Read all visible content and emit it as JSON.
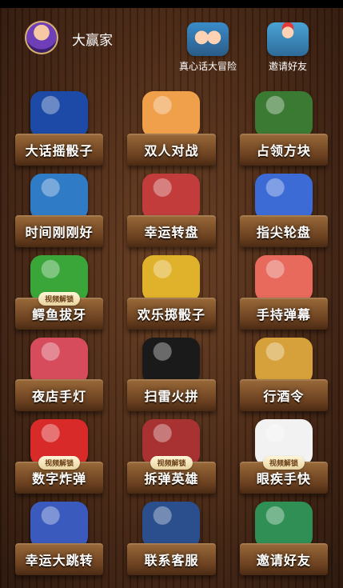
{
  "header": {
    "username": "大赢家",
    "actions": [
      {
        "label": "真心话大冒险",
        "icon": "truth-or-dare-icon"
      },
      {
        "label": "邀请好友",
        "icon": "invite-friend-icon"
      }
    ]
  },
  "games": [
    {
      "label": "大话摇骰子",
      "icon": "dice-cup-icon",
      "color": "#1c4aa6",
      "badge": ""
    },
    {
      "label": "双人对战",
      "icon": "fists-battle-icon",
      "color": "#f0a04b",
      "badge": ""
    },
    {
      "label": "占领方块",
      "icon": "soldiers-icon",
      "color": "#3b7a33",
      "badge": ""
    },
    {
      "label": "时间刚刚好",
      "icon": "clock-person-icon",
      "color": "#2f7bc6",
      "badge": ""
    },
    {
      "label": "幸运转盘",
      "icon": "lucky-wheel-icon",
      "color": "#c23c3c",
      "badge": ""
    },
    {
      "label": "指尖轮盘",
      "icon": "finger-spinner-icon",
      "color": "#3c6bd6",
      "badge": ""
    },
    {
      "label": "鳄鱼拔牙",
      "icon": "crocodile-icon",
      "color": "#3aa63a",
      "badge": "视频解锁"
    },
    {
      "label": "欢乐掷骰子",
      "icon": "golden-dice-icon",
      "color": "#e0b12a",
      "badge": ""
    },
    {
      "label": "手持弹幕",
      "icon": "handheld-phone-icon",
      "color": "#e76a5c",
      "badge": ""
    },
    {
      "label": "夜店手灯",
      "icon": "nightclub-light-icon",
      "color": "#d64c5c",
      "badge": ""
    },
    {
      "label": "扫雷火拼",
      "icon": "bombs-icon",
      "color": "#1a1a1a",
      "badge": ""
    },
    {
      "label": "行酒令",
      "icon": "cheers-icon",
      "color": "#d6a13a",
      "badge": ""
    },
    {
      "label": "数字炸弹",
      "icon": "number-bomb-icon",
      "color": "#d92a2a",
      "badge": "视频解锁"
    },
    {
      "label": "拆弹英雄",
      "icon": "defuse-bomb-icon",
      "color": "#a83232",
      "badge": "视频解锁"
    },
    {
      "label": "眼疾手快",
      "icon": "eyes-icon",
      "color": "#f2f2f2",
      "badge": "视频解锁"
    },
    {
      "label": "幸运大跳转",
      "icon": "jumping-people-icon",
      "color": "#3a5bbd",
      "badge": ""
    },
    {
      "label": "联系客服",
      "icon": "customer-service-icon",
      "color": "#2a4f8c",
      "badge": ""
    },
    {
      "label": "邀请好友",
      "icon": "invite-group-icon",
      "color": "#2f8f55",
      "badge": ""
    }
  ]
}
